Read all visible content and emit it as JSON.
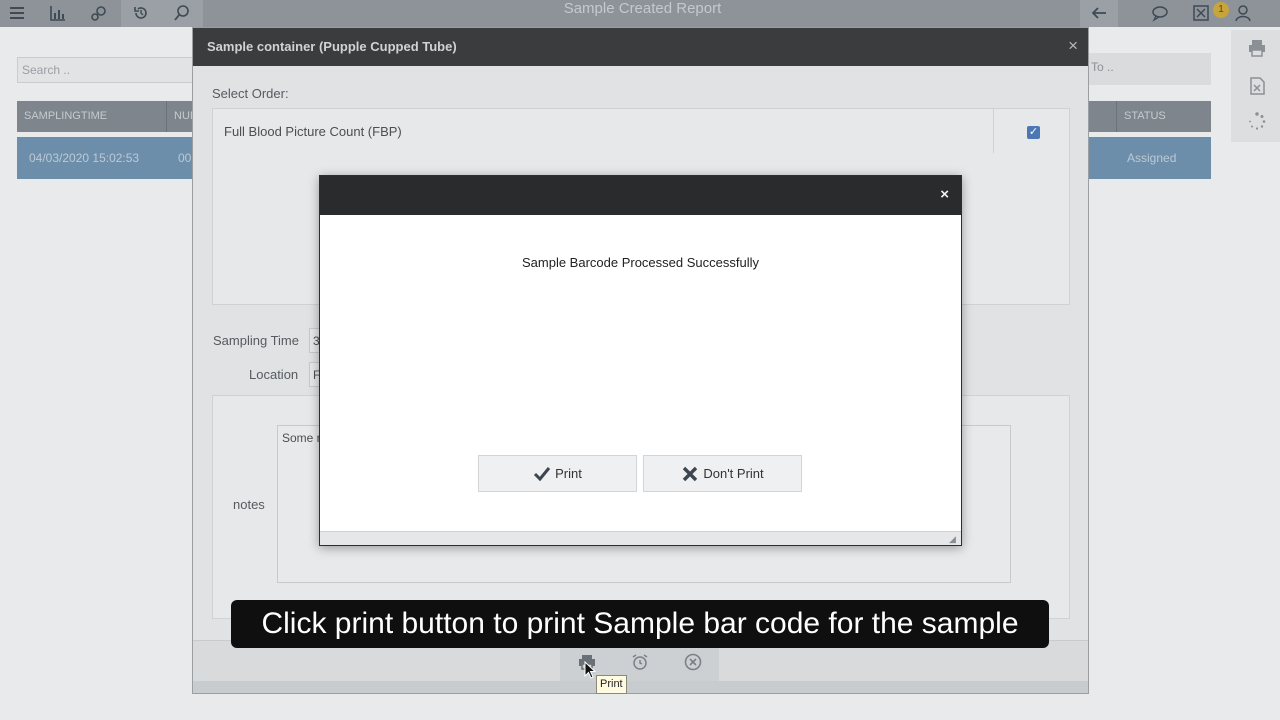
{
  "app": {
    "title": "Sample Created Report",
    "notification_count": "1",
    "search_placeholder": "Search ..",
    "to_label": "To ..",
    "table": {
      "headers": [
        "SAMPLINGTIME",
        "NUI",
        "STATUS"
      ],
      "row": {
        "sampling_time": "04/03/2020 15:02:53",
        "num": "00",
        "status": "Assigned"
      }
    }
  },
  "outer_dialog": {
    "title": "Sample container (Pupple Cupped Tube)",
    "select_order_label": "Select Order:",
    "order_item": "Full Blood Picture Count (FBP)",
    "order_checked": true,
    "sampling_time_label": "Sampling Time",
    "sampling_time_value": "3",
    "location_label": "Location",
    "location_value": "F",
    "notes_label": "notes",
    "notes_value": "Some r",
    "close_glyph": "×"
  },
  "modal": {
    "message": "Sample Barcode Processed Successfully",
    "print_label": "Print",
    "dont_print_label": "Don't Print",
    "close_glyph": "×"
  },
  "caption": "Click print button to print Sample bar code for the sample",
  "tooltip": "Print",
  "colors": {
    "modal_header": "#2a2b2c",
    "outer_header": "#3a3c3e",
    "checkbox": "#4d77b4",
    "row_selected": "#6d8eaa"
  }
}
